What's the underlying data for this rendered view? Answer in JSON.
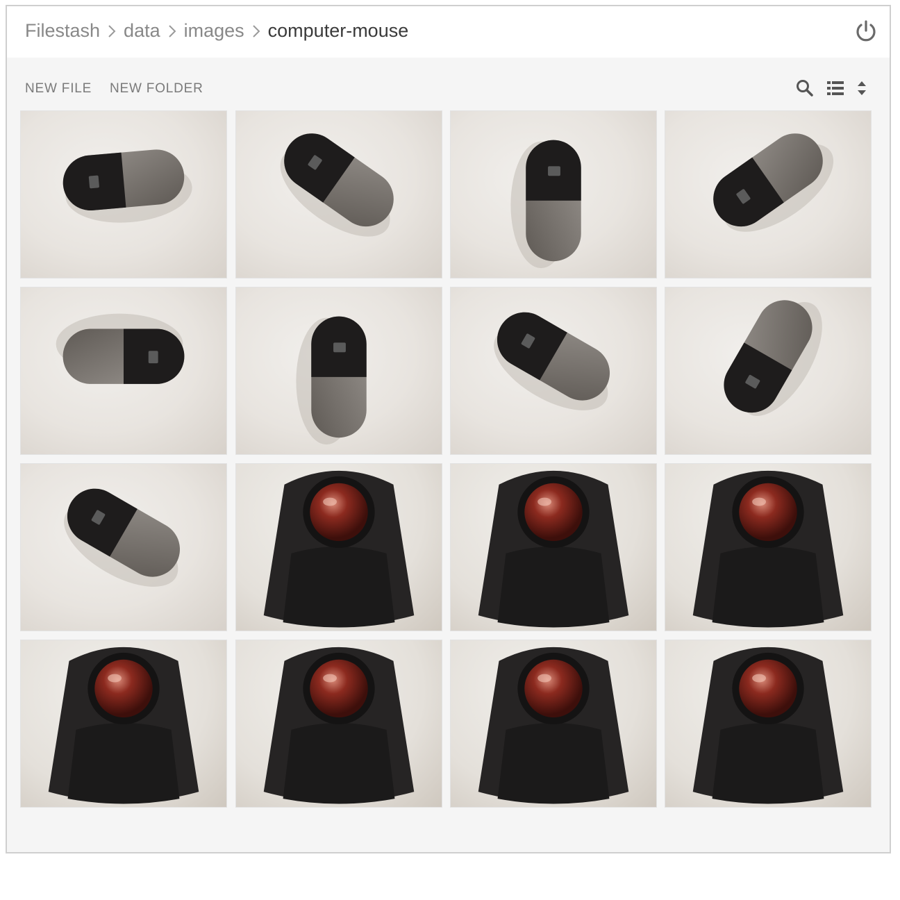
{
  "breadcrumb": {
    "items": [
      "Filestash",
      "data",
      "images"
    ],
    "current": "computer-mouse"
  },
  "toolbar": {
    "new_file_label": "NEW FILE",
    "new_folder_label": "NEW FOLDER",
    "icons": [
      "search-icon",
      "list-view-icon",
      "sort-icon"
    ]
  },
  "header": {
    "icons": [
      "power-icon"
    ]
  },
  "colors": {
    "text_muted": "#888888",
    "text_current": "#3a3a3a",
    "panel_bg": "#f5f5f5",
    "border": "#cfcfcf"
  },
  "gallery": {
    "columns": 4,
    "rows": 4,
    "thumbnails": [
      {
        "subject": "silver-black wireless mouse"
      },
      {
        "subject": "silver-black wireless mouse"
      },
      {
        "subject": "silver-black wireless mouse"
      },
      {
        "subject": "silver-black wireless mouse"
      },
      {
        "subject": "silver-black wireless mouse"
      },
      {
        "subject": "silver-black wireless mouse"
      },
      {
        "subject": "silver-black wireless mouse"
      },
      {
        "subject": "silver-black wireless mouse"
      },
      {
        "subject": "silver-black wireless mouse"
      },
      {
        "subject": "trackball with red ball"
      },
      {
        "subject": "trackball with red ball"
      },
      {
        "subject": "trackball with red ball"
      },
      {
        "subject": "trackball with red ball"
      },
      {
        "subject": "trackball with red ball"
      },
      {
        "subject": "trackball with red ball"
      },
      {
        "subject": "trackball with red ball"
      }
    ]
  }
}
